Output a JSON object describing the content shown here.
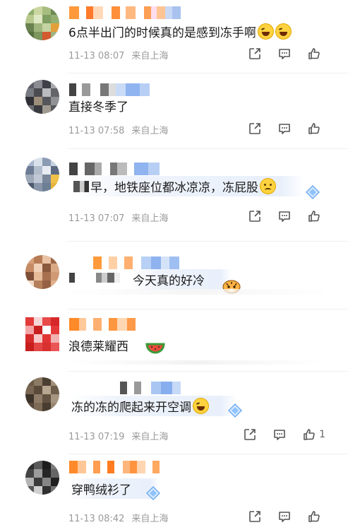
{
  "comments": [
    {
      "text": "6点半出门的时候真的是感到冻手啊",
      "time": "11-13 08:07",
      "location": "来自上海",
      "likes": ""
    },
    {
      "text": "直接冬季了",
      "time": "11-13 07:58",
      "location": "来自上海",
      "likes": ""
    },
    {
      "text": "早，地铁座位都冰凉凉，冻屁股",
      "time": "11-13 07:07",
      "location": "来自上海",
      "likes": ""
    },
    {
      "text": "今天真的好冷",
      "time": "",
      "location": "",
      "likes": ""
    },
    {
      "text": "浪德莱耀西",
      "time": "",
      "location": "",
      "likes": ""
    },
    {
      "text": "冻的冻的爬起来开空调",
      "time": "11-13 07:19",
      "location": "来自上海",
      "likes": "1"
    },
    {
      "text": "穿鸭绒衫了",
      "time": "11-13 08:42",
      "location": "来自上海",
      "likes": ""
    }
  ],
  "icons": {
    "share": "share-icon",
    "comment": "comment-icon",
    "like": "thumbs-up-icon",
    "emoji_laugh": "laugh-crying-emoji",
    "emoji_sad": "sad-face-emoji",
    "emoji_watermelon": "watermelon-emoji",
    "emoji_tiger": "tiger-emoji",
    "badge": "diamond-badge-icon"
  },
  "colors": {
    "meta_text": "#9a9a9a",
    "body_text": "#1a1a1a",
    "icon": "#555555"
  }
}
